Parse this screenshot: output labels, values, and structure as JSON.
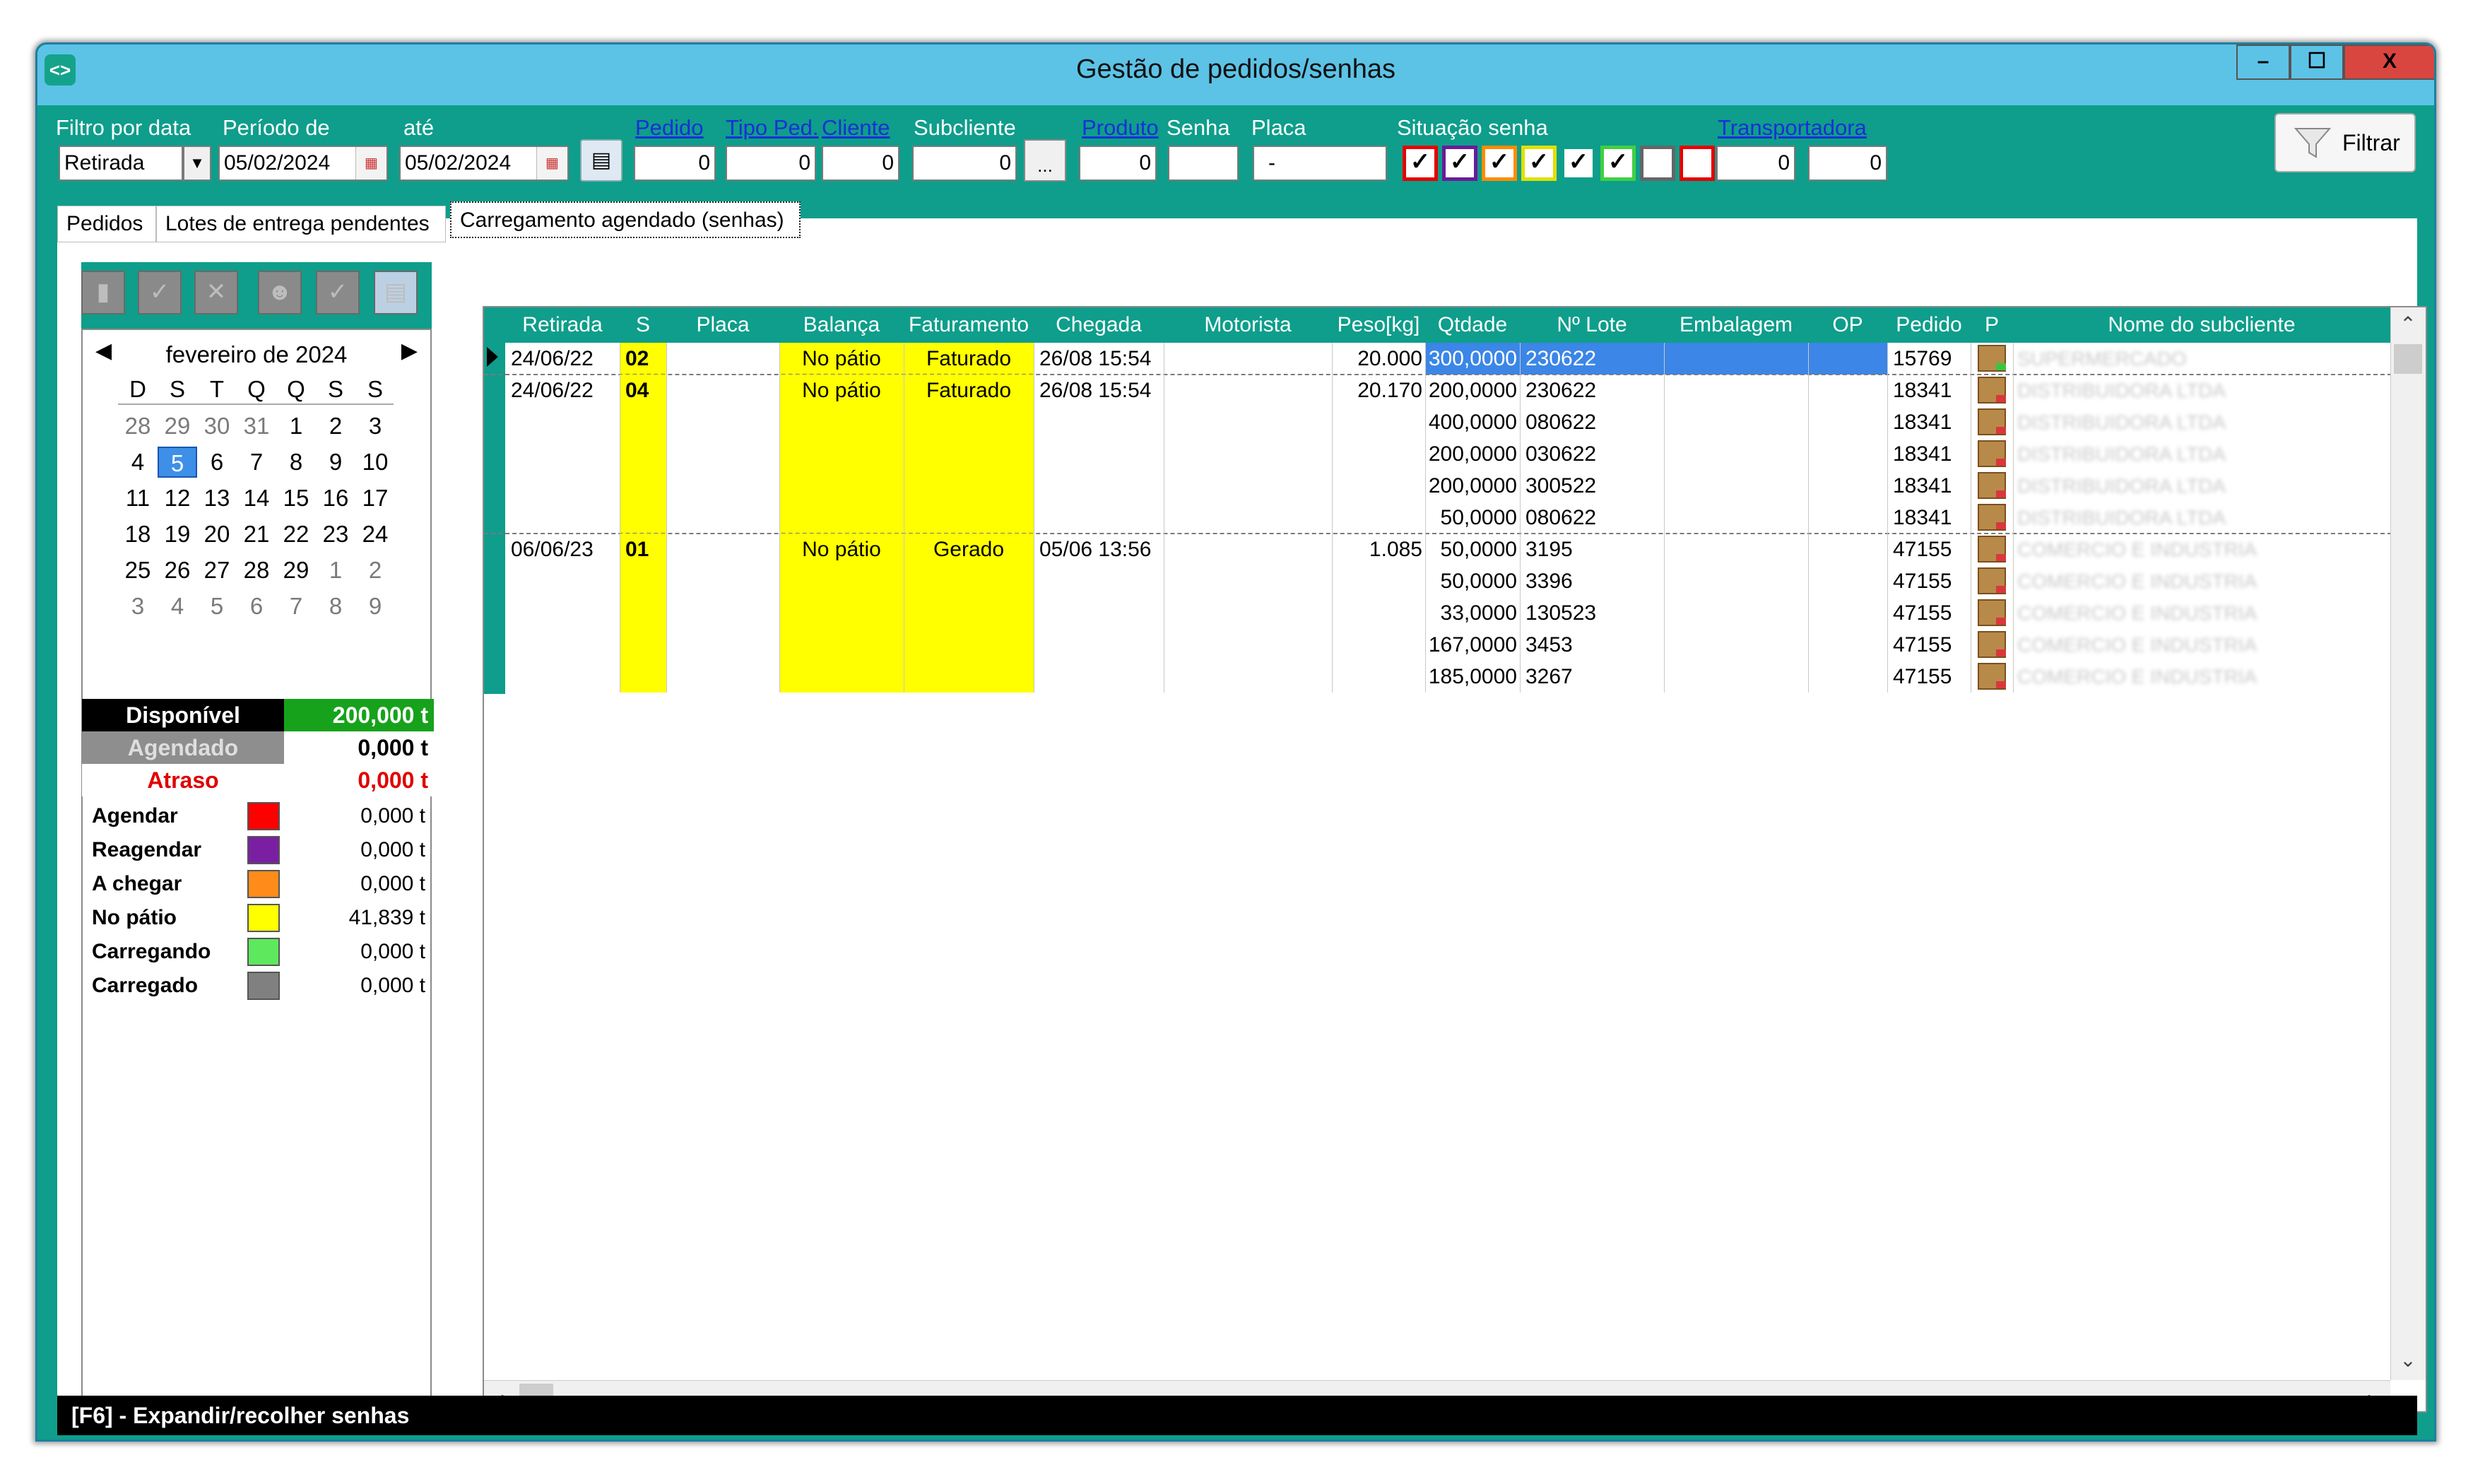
{
  "window": {
    "title": "Gestão de pedidos/senhas",
    "icon": "app-icon",
    "buttons": {
      "minimize": "–",
      "maximize": "☐",
      "close": "X"
    }
  },
  "filters": {
    "filtro_label": "Filtro por data",
    "filtro_value": "Retirada",
    "periodo_label": "Período de",
    "periodo_de": "05/02/2024",
    "ate_label": "até",
    "ate_value": "05/02/2024",
    "pedido_label": "Pedido",
    "pedido_value": "0",
    "tipo_label": "Tipo Ped.",
    "tipo_value": "0",
    "cliente_label": "Cliente",
    "cliente_value": "0",
    "subcliente_label": "Subcliente",
    "subcliente_value": "0",
    "produto_label": "Produto",
    "produto_value": "0",
    "senha_label": "Senha",
    "senha_value": "",
    "placa_label": "Placa",
    "placa_value": "-",
    "situacao_label": "Situação senha",
    "situacao_checks": [
      {
        "border": "#e60000",
        "checked": "✓"
      },
      {
        "border": "#6a1b9a",
        "checked": "✓"
      },
      {
        "border": "#ff8c00",
        "checked": "✓"
      },
      {
        "border": "#e0e000",
        "checked": "✓"
      },
      {
        "border": "#0e9e8b",
        "checked": "✓"
      },
      {
        "border": "#40d040",
        "checked": "✓"
      },
      {
        "border": "#666666",
        "checked": ""
      },
      {
        "border": "#e60000",
        "checked": ""
      }
    ],
    "transportadora_label": "Transportadora",
    "transportadora_value1": "0",
    "transportadora_value2": "0",
    "ellipsis": "...",
    "filtrar_label": "Filtrar"
  },
  "tabs": [
    "Pedidos",
    "Lotes de entrega pendentes",
    "Carregamento agendado (senhas)"
  ],
  "calendar": {
    "month_label": "fevereiro de 2024",
    "dows": [
      "D",
      "S",
      "T",
      "Q",
      "Q",
      "S",
      "S"
    ],
    "weeks": [
      [
        "28",
        "29",
        "30",
        "31",
        "1",
        "2",
        "3"
      ],
      [
        "4",
        "5",
        "6",
        "7",
        "8",
        "9",
        "10"
      ],
      [
        "11",
        "12",
        "13",
        "14",
        "15",
        "16",
        "17"
      ],
      [
        "18",
        "19",
        "20",
        "21",
        "22",
        "23",
        "24"
      ],
      [
        "25",
        "26",
        "27",
        "28",
        "29",
        "1",
        "2"
      ],
      [
        "3",
        "4",
        "5",
        "6",
        "7",
        "8",
        "9"
      ]
    ],
    "selected": "5"
  },
  "summary": {
    "disponivel_label": "Disponível",
    "disponivel_value": "200,000 t",
    "agendado_label": "Agendado",
    "agendado_value": "0,000 t",
    "atraso_label": "Atraso",
    "atraso_value": "0,000 t"
  },
  "legend": [
    {
      "label": "Agendar",
      "color": "#ff0000",
      "value": "0,000 t"
    },
    {
      "label": "Reagendar",
      "color": "#7b1fa2",
      "value": "0,000 t"
    },
    {
      "label": "A chegar",
      "color": "#ff8c1a",
      "value": "0,000 t"
    },
    {
      "label": "No pátio",
      "color": "#ffff00",
      "value": "41,839 t"
    },
    {
      "label": "Carregando",
      "color": "#5ee85e",
      "value": "0,000 t"
    },
    {
      "label": "Carregado",
      "color": "#808080",
      "value": "0,000 t"
    }
  ],
  "grid": {
    "headers": [
      "Retirada",
      "S",
      "Placa",
      "Balança",
      "Faturamento",
      "Chegada",
      "Motorista",
      "Peso[kg]",
      "Qtdade",
      "Nº Lote",
      "Embalagem",
      "OP",
      "Pedido",
      "P",
      "Nome do subcliente"
    ],
    "groups": [
      {
        "retirada": "24/06/22",
        "s": "02",
        "placa": "",
        "balanca": "No pátio",
        "faturamento": "Faturado",
        "chegada": "26/08 15:54",
        "motorista": "",
        "peso": "20.000",
        "rows": [
          {
            "qtd": "300,0000",
            "lote": "230622",
            "pedido": "15769",
            "nome": "SUPERMERCADO"
          }
        ]
      },
      {
        "retirada": "24/06/22",
        "s": "04",
        "placa": "",
        "balanca": "No pátio",
        "faturamento": "Faturado",
        "chegada": "26/08 15:54",
        "motorista": "",
        "peso": "20.170",
        "rows": [
          {
            "qtd": "200,0000",
            "lote": "230622",
            "pedido": "18341",
            "nome": "DISTRIBUIDORA LTDA"
          },
          {
            "qtd": "400,0000",
            "lote": "080622",
            "pedido": "18341",
            "nome": "DISTRIBUIDORA LTDA"
          },
          {
            "qtd": "200,0000",
            "lote": "030622",
            "pedido": "18341",
            "nome": "DISTRIBUIDORA LTDA"
          },
          {
            "qtd": "200,0000",
            "lote": "300522",
            "pedido": "18341",
            "nome": "DISTRIBUIDORA LTDA"
          },
          {
            "qtd": "50,0000",
            "lote": "080622",
            "pedido": "18341",
            "nome": "DISTRIBUIDORA LTDA"
          }
        ]
      },
      {
        "retirada": "06/06/23",
        "s": "01",
        "placa": "",
        "balanca": "No pátio",
        "faturamento": "Gerado",
        "chegada": "05/06 13:56",
        "motorista": "",
        "peso": "1.085",
        "rows": [
          {
            "qtd": "50,0000",
            "lote": "3195",
            "pedido": "47155",
            "nome": "COMERCIO E INDUSTRIA"
          },
          {
            "qtd": "50,0000",
            "lote": "3396",
            "pedido": "47155",
            "nome": "COMERCIO E INDUSTRIA"
          },
          {
            "qtd": "33,0000",
            "lote": "130523",
            "pedido": "47155",
            "nome": "COMERCIO E INDUSTRIA"
          },
          {
            "qtd": "167,0000",
            "lote": "3453",
            "pedido": "47155",
            "nome": "COMERCIO E INDUSTRIA"
          },
          {
            "qtd": "185,0000",
            "lote": "3267",
            "pedido": "47155",
            "nome": "COMERCIO E INDUSTRIA"
          }
        ]
      }
    ]
  },
  "status_bar": "[F6] - Expandir/recolher senhas"
}
